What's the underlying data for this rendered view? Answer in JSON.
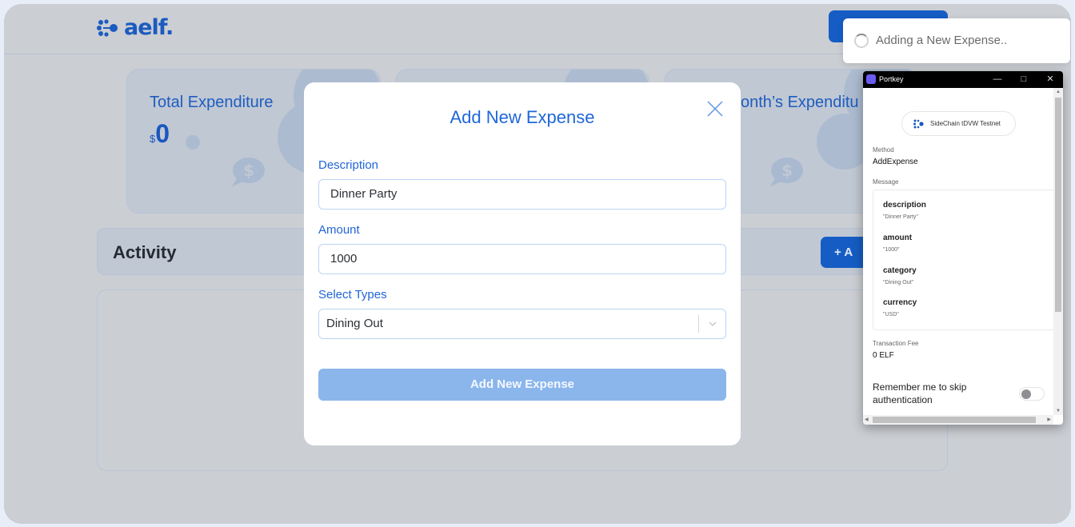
{
  "app": {
    "brand": "aelf.",
    "brand_color": "#1c5bbf",
    "accent_color": "#155dc4"
  },
  "cards": [
    {
      "title": "Total Expenditure",
      "currency": "$",
      "value": "0"
    },
    {
      "title": "",
      "currency": "",
      "value": ""
    },
    {
      "title": "onth’s Expenditu",
      "currency": "",
      "value": ""
    }
  ],
  "activity": {
    "title": "Activity",
    "add_button_label": "+  A"
  },
  "modal": {
    "title": "Add New Expense",
    "close_icon": "close-icon",
    "fields": {
      "description": {
        "label": "Description",
        "value": "Dinner Party"
      },
      "amount": {
        "label": "Amount",
        "value": "1000"
      },
      "type": {
        "label": "Select Types",
        "value": "Dining Out"
      }
    },
    "submit_label": "Add New Expense"
  },
  "toast": {
    "text": "Adding a New Expense.."
  },
  "portkey": {
    "window_title": "Portkey",
    "chain": "SideChain tDVW Testnet",
    "method_label": "Method",
    "method": "AddExpense",
    "message_label": "Message",
    "message": [
      {
        "key": "description",
        "value": "\"Dinner Party\""
      },
      {
        "key": "amount",
        "value": "\"1000\""
      },
      {
        "key": "category",
        "value": "\"Dining Out\""
      },
      {
        "key": "currency",
        "value": "\"USD\""
      }
    ],
    "fee_label": "Transaction Fee",
    "fee": "0 ELF",
    "remember_label": "Remember me to skip authentication",
    "remember_enabled": false
  }
}
